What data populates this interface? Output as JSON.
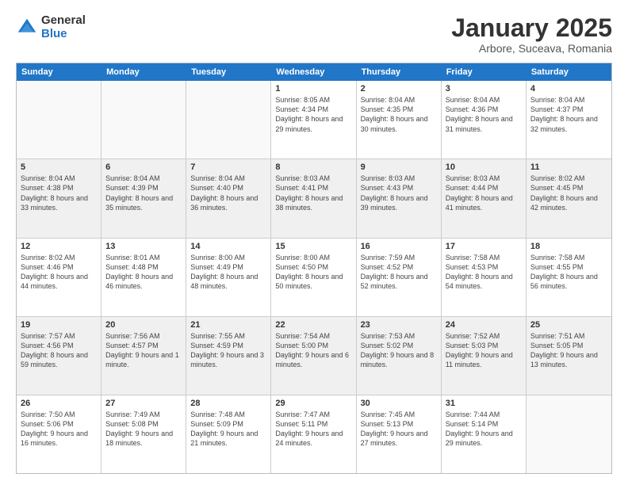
{
  "logo": {
    "general": "General",
    "blue": "Blue"
  },
  "title": {
    "month": "January 2025",
    "location": "Arbore, Suceava, Romania"
  },
  "weekdays": [
    "Sunday",
    "Monday",
    "Tuesday",
    "Wednesday",
    "Thursday",
    "Friday",
    "Saturday"
  ],
  "rows": [
    [
      {
        "day": "",
        "info": ""
      },
      {
        "day": "",
        "info": ""
      },
      {
        "day": "",
        "info": ""
      },
      {
        "day": "1",
        "info": "Sunrise: 8:05 AM\nSunset: 4:34 PM\nDaylight: 8 hours and 29 minutes."
      },
      {
        "day": "2",
        "info": "Sunrise: 8:04 AM\nSunset: 4:35 PM\nDaylight: 8 hours and 30 minutes."
      },
      {
        "day": "3",
        "info": "Sunrise: 8:04 AM\nSunset: 4:36 PM\nDaylight: 8 hours and 31 minutes."
      },
      {
        "day": "4",
        "info": "Sunrise: 8:04 AM\nSunset: 4:37 PM\nDaylight: 8 hours and 32 minutes."
      }
    ],
    [
      {
        "day": "5",
        "info": "Sunrise: 8:04 AM\nSunset: 4:38 PM\nDaylight: 8 hours and 33 minutes."
      },
      {
        "day": "6",
        "info": "Sunrise: 8:04 AM\nSunset: 4:39 PM\nDaylight: 8 hours and 35 minutes."
      },
      {
        "day": "7",
        "info": "Sunrise: 8:04 AM\nSunset: 4:40 PM\nDaylight: 8 hours and 36 minutes."
      },
      {
        "day": "8",
        "info": "Sunrise: 8:03 AM\nSunset: 4:41 PM\nDaylight: 8 hours and 38 minutes."
      },
      {
        "day": "9",
        "info": "Sunrise: 8:03 AM\nSunset: 4:43 PM\nDaylight: 8 hours and 39 minutes."
      },
      {
        "day": "10",
        "info": "Sunrise: 8:03 AM\nSunset: 4:44 PM\nDaylight: 8 hours and 41 minutes."
      },
      {
        "day": "11",
        "info": "Sunrise: 8:02 AM\nSunset: 4:45 PM\nDaylight: 8 hours and 42 minutes."
      }
    ],
    [
      {
        "day": "12",
        "info": "Sunrise: 8:02 AM\nSunset: 4:46 PM\nDaylight: 8 hours and 44 minutes."
      },
      {
        "day": "13",
        "info": "Sunrise: 8:01 AM\nSunset: 4:48 PM\nDaylight: 8 hours and 46 minutes."
      },
      {
        "day": "14",
        "info": "Sunrise: 8:00 AM\nSunset: 4:49 PM\nDaylight: 8 hours and 48 minutes."
      },
      {
        "day": "15",
        "info": "Sunrise: 8:00 AM\nSunset: 4:50 PM\nDaylight: 8 hours and 50 minutes."
      },
      {
        "day": "16",
        "info": "Sunrise: 7:59 AM\nSunset: 4:52 PM\nDaylight: 8 hours and 52 minutes."
      },
      {
        "day": "17",
        "info": "Sunrise: 7:58 AM\nSunset: 4:53 PM\nDaylight: 8 hours and 54 minutes."
      },
      {
        "day": "18",
        "info": "Sunrise: 7:58 AM\nSunset: 4:55 PM\nDaylight: 8 hours and 56 minutes."
      }
    ],
    [
      {
        "day": "19",
        "info": "Sunrise: 7:57 AM\nSunset: 4:56 PM\nDaylight: 8 hours and 59 minutes."
      },
      {
        "day": "20",
        "info": "Sunrise: 7:56 AM\nSunset: 4:57 PM\nDaylight: 9 hours and 1 minute."
      },
      {
        "day": "21",
        "info": "Sunrise: 7:55 AM\nSunset: 4:59 PM\nDaylight: 9 hours and 3 minutes."
      },
      {
        "day": "22",
        "info": "Sunrise: 7:54 AM\nSunset: 5:00 PM\nDaylight: 9 hours and 6 minutes."
      },
      {
        "day": "23",
        "info": "Sunrise: 7:53 AM\nSunset: 5:02 PM\nDaylight: 9 hours and 8 minutes."
      },
      {
        "day": "24",
        "info": "Sunrise: 7:52 AM\nSunset: 5:03 PM\nDaylight: 9 hours and 11 minutes."
      },
      {
        "day": "25",
        "info": "Sunrise: 7:51 AM\nSunset: 5:05 PM\nDaylight: 9 hours and 13 minutes."
      }
    ],
    [
      {
        "day": "26",
        "info": "Sunrise: 7:50 AM\nSunset: 5:06 PM\nDaylight: 9 hours and 16 minutes."
      },
      {
        "day": "27",
        "info": "Sunrise: 7:49 AM\nSunset: 5:08 PM\nDaylight: 9 hours and 18 minutes."
      },
      {
        "day": "28",
        "info": "Sunrise: 7:48 AM\nSunset: 5:09 PM\nDaylight: 9 hours and 21 minutes."
      },
      {
        "day": "29",
        "info": "Sunrise: 7:47 AM\nSunset: 5:11 PM\nDaylight: 9 hours and 24 minutes."
      },
      {
        "day": "30",
        "info": "Sunrise: 7:45 AM\nSunset: 5:13 PM\nDaylight: 9 hours and 27 minutes."
      },
      {
        "day": "31",
        "info": "Sunrise: 7:44 AM\nSunset: 5:14 PM\nDaylight: 9 hours and 29 minutes."
      },
      {
        "day": "",
        "info": ""
      }
    ]
  ]
}
